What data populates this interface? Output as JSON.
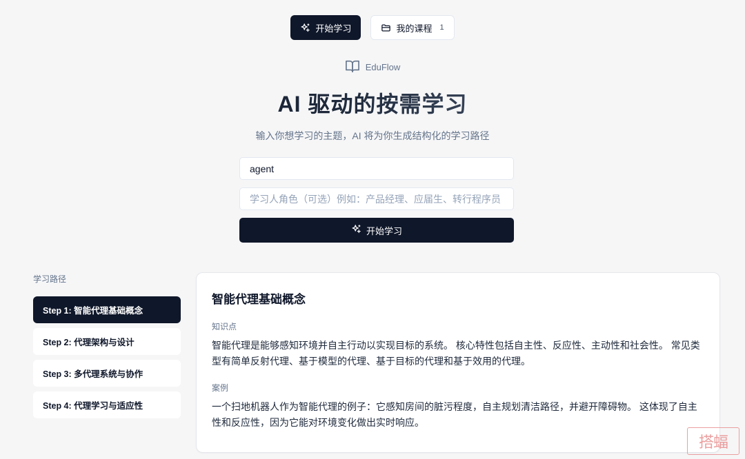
{
  "nav": {
    "start_label": "开始学习",
    "courses_label": "我的课程",
    "courses_count": "1"
  },
  "brand": {
    "name": "EduFlow"
  },
  "hero": {
    "title": "AI 驱动的按需学习",
    "subtitle": "输入你想学习的主题，AI 将为你生成结构化的学习路径"
  },
  "form": {
    "topic_value": "agent",
    "role_placeholder": "学习人角色（可选）例如：产品经理、应届生、转行程序员",
    "submit_label": "开始学习"
  },
  "sidebar": {
    "title": "学习路径",
    "steps": [
      {
        "label": "Step 1: 智能代理基础概念",
        "active": true
      },
      {
        "label": "Step 2: 代理架构与设计",
        "active": false
      },
      {
        "label": "Step 3: 多代理系统与协作",
        "active": false
      },
      {
        "label": "Step 4: 代理学习与适应性",
        "active": false
      }
    ]
  },
  "content": {
    "title": "智能代理基础概念",
    "knowledge_label": "知识点",
    "knowledge_text": "智能代理是能够感知环境并自主行动以实现目标的系统。 核心特性包括自主性、反应性、主动性和社会性。 常见类型有简单反射代理、基于模型的代理、基于目标的代理和基于效用的代理。",
    "example_label": "案例",
    "example_text": "一个扫地机器人作为智能代理的例子：它感知房间的脏污程度，自主规划清洁路径，并避开障碍物。 这体现了自主性和反应性，因为它能对环境变化做出实时响应。"
  },
  "watermark": {
    "text": "搭蝠"
  },
  "colors": {
    "primary": "#0f172a",
    "muted": "#64748b",
    "background": "#f6f6f7"
  }
}
